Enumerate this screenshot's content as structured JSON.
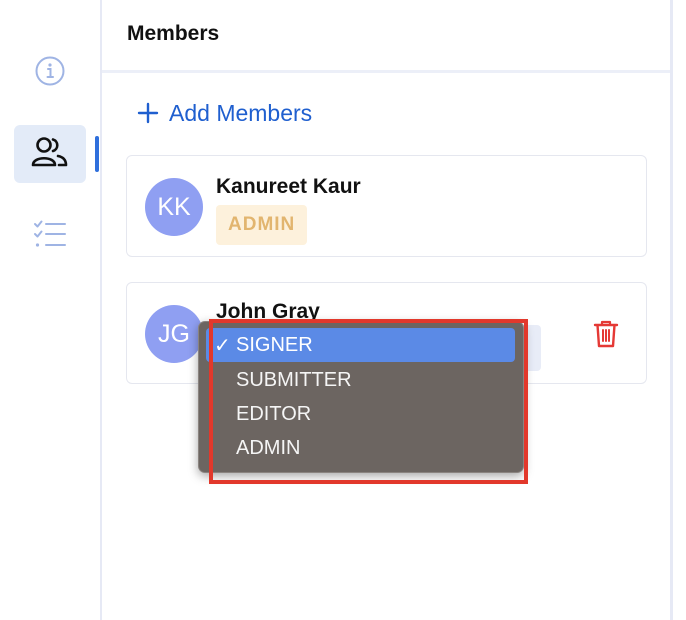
{
  "panel": {
    "title": "Members",
    "add_label": "Add Members"
  },
  "sidebar": {
    "items": [
      {
        "icon": "info-icon",
        "active": false
      },
      {
        "icon": "users-icon",
        "active": true
      },
      {
        "icon": "checklist-icon",
        "active": false
      }
    ]
  },
  "members": [
    {
      "initials": "KK",
      "name": "Kanureet Kaur",
      "role": "ADMIN"
    },
    {
      "initials": "JG",
      "name": "John Gray",
      "role": "SIGNER"
    }
  ],
  "role_dropdown": {
    "selected": "SIGNER",
    "check_mark": "✓",
    "options": [
      "SIGNER",
      "SUBMITTER",
      "EDITOR",
      "ADMIN"
    ]
  },
  "colors": {
    "accent": "#1f5fcf",
    "avatar": "#8f9ff2",
    "admin_badge_bg": "#fdf1dc",
    "admin_badge_text": "#e2b56f",
    "delete": "#e53935",
    "dropdown_bg": "#6c6561",
    "dropdown_selected": "#5b8ae6",
    "highlight": "#e2382b"
  }
}
